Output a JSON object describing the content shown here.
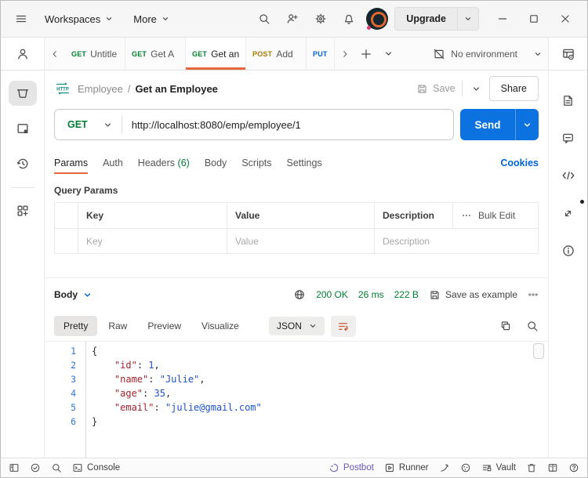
{
  "colors": {
    "accent_orange": "#e8663d",
    "send_blue": "#0b72e0",
    "get_green": "#007f31",
    "post_yellow": "#ad7a03",
    "put_blue": "#0265d2",
    "link_blue": "#0265d2",
    "success_green": "#007f31",
    "postbot_purple": "#6e56b8",
    "json_key_red": "#a6242f",
    "json_value_blue": "#1f51c9",
    "line_number_blue": "#3173dd"
  },
  "titlebar": {
    "workspaces_label": "Workspaces",
    "more_label": "More",
    "upgrade_label": "Upgrade"
  },
  "tabbar": {
    "tabs": [
      {
        "method": "GET",
        "label": "Untitle"
      },
      {
        "method": "GET",
        "label": "Get A"
      },
      {
        "method": "GET",
        "label": "Get an"
      },
      {
        "method": "POST",
        "label": "Add"
      },
      {
        "method": "PUT",
        "label": ""
      }
    ],
    "environment": {
      "label": "No environment"
    }
  },
  "request": {
    "collection": "Employee",
    "separator": "/",
    "name": "Get an Employee",
    "save_label": "Save",
    "share_label": "Share",
    "method": "GET",
    "url": "http://localhost:8080/emp/employee/1",
    "send_label": "Send"
  },
  "request_tabs": {
    "params": "Params",
    "auth": "Auth",
    "headers": "Headers",
    "headers_count": "(6)",
    "body": "Body",
    "scripts": "Scripts",
    "settings": "Settings",
    "cookies": "Cookies"
  },
  "query_params": {
    "title": "Query Params",
    "col_key": "Key",
    "col_value": "Value",
    "col_description": "Description",
    "bulk_edit": "Bulk Edit",
    "row_placeholders": {
      "key": "Key",
      "value": "Value",
      "description": "Description"
    }
  },
  "response": {
    "body_label": "Body",
    "status": "200 OK",
    "time": "26 ms",
    "size": "222 B",
    "save_as_example": "Save as example",
    "views": {
      "pretty": "Pretty",
      "raw": "Raw",
      "preview": "Preview",
      "visualize": "Visualize"
    },
    "format": "JSON",
    "code": {
      "lines": [
        [
          {
            "t": "{",
            "c": "p"
          }
        ],
        [
          {
            "t": "    ",
            "c": "w"
          },
          {
            "t": "\"id\"",
            "c": "k"
          },
          {
            "t": ": ",
            "c": "p"
          },
          {
            "t": "1",
            "c": "n"
          },
          {
            "t": ",",
            "c": "p"
          }
        ],
        [
          {
            "t": "    ",
            "c": "w"
          },
          {
            "t": "\"name\"",
            "c": "k"
          },
          {
            "t": ": ",
            "c": "p"
          },
          {
            "t": "\"Julie\"",
            "c": "s"
          },
          {
            "t": ",",
            "c": "p"
          }
        ],
        [
          {
            "t": "    ",
            "c": "w"
          },
          {
            "t": "\"age\"",
            "c": "k"
          },
          {
            "t": ": ",
            "c": "p"
          },
          {
            "t": "35",
            "c": "n"
          },
          {
            "t": ",",
            "c": "p"
          }
        ],
        [
          {
            "t": "    ",
            "c": "w"
          },
          {
            "t": "\"email\"",
            "c": "k"
          },
          {
            "t": ": ",
            "c": "p"
          },
          {
            "t": "\"julie@gmail.com\"",
            "c": "s"
          }
        ],
        [
          {
            "t": "}",
            "c": "p"
          }
        ]
      ]
    }
  },
  "statusbar": {
    "console": "Console",
    "postbot": "Postbot",
    "runner": "Runner",
    "vault": "Vault"
  }
}
